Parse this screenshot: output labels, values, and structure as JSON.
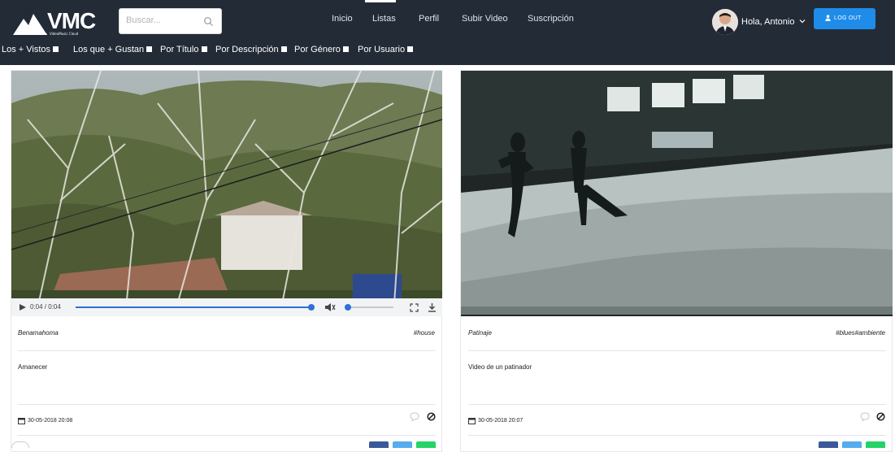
{
  "brand": {
    "name": "VMC",
    "tagline": "VideoMusic Cloud"
  },
  "search": {
    "placeholder": "Buscar..."
  },
  "nav": [
    "Inicio",
    "Listas",
    "Perfil",
    "Subir Video",
    "Suscripción"
  ],
  "user": {
    "greeting": "Hola, Antonio"
  },
  "logout_label": "LOG OUT",
  "filters": [
    "Los + Vistos",
    "Los que + Gustan",
    "Por Título",
    "Por Descripción",
    "Por Género",
    "Por Usuario"
  ],
  "videos": [
    {
      "title": "Benamahoma",
      "tags": "#house",
      "description": "Amanecer",
      "date": "30-05-2018 20:08",
      "player": {
        "time": "0:04 / 0:04",
        "progress": 1.0,
        "volume": 0.0
      }
    },
    {
      "title": "Patinaje",
      "tags": "#blues#ambiente",
      "description": "Video de un patinador",
      "date": "30-05-2018 20:07"
    }
  ],
  "colors": {
    "topbar": "#232b37",
    "accent": "#1e8ce8",
    "share_facebook": "#3b5998",
    "share_twitter": "#55acee",
    "share_whatsapp": "#25d366"
  }
}
